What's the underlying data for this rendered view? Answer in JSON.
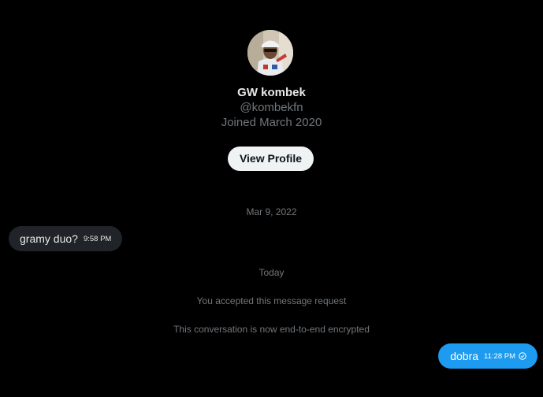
{
  "profile": {
    "name": "GW kombek",
    "handle": "@kombekfn",
    "joined": "Joined March 2020",
    "view_profile_label": "View Profile",
    "avatar_icon": "user-avatar-photo"
  },
  "conversation": {
    "date_separator_1": "Mar 9, 2022",
    "messages": [
      {
        "direction": "incoming",
        "text": "gramy duo?",
        "time": "9:58 PM"
      },
      {
        "direction": "outgoing",
        "text": "dobra",
        "time": "11:28 PM",
        "status_icon": "sent-check-icon"
      }
    ],
    "date_separator_2": "Today",
    "system_notices": [
      "You accepted this message request",
      "This conversation is now end-to-end encrypted"
    ]
  },
  "colors": {
    "background": "#000000",
    "outgoing_bubble": "#1d9bf0",
    "incoming_bubble": "#202327",
    "secondary_text": "#71767b",
    "primary_text": "#e7e9ea"
  }
}
